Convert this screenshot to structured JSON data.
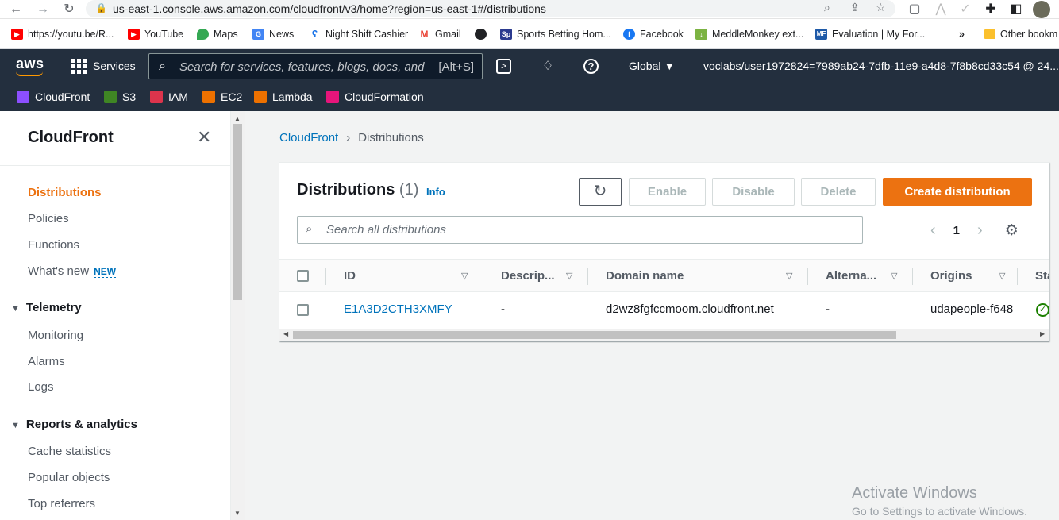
{
  "browser": {
    "url": "us-east-1.console.aws.amazon.com/cloudfront/v3/home?region=us-east-1#/distributions",
    "bookmarks": [
      {
        "label": "https://youtu.be/R...",
        "icon": "youtube-icon"
      },
      {
        "label": "YouTube",
        "icon": "youtube-icon"
      },
      {
        "label": "Maps",
        "icon": "maps-icon"
      },
      {
        "label": "News",
        "icon": "news-icon"
      },
      {
        "label": "Night Shift Cashier",
        "icon": "bookmark-icon"
      },
      {
        "label": "Gmail",
        "icon": "gmail-icon"
      },
      {
        "label": "",
        "icon": "globe-icon"
      },
      {
        "label": "Sports Betting Hom...",
        "icon": "sp-icon"
      },
      {
        "label": "Facebook",
        "icon": "facebook-icon"
      },
      {
        "label": "MeddleMonkey ext...",
        "icon": "download-icon"
      },
      {
        "label": "Evaluation | My For...",
        "icon": "mf-icon"
      }
    ],
    "overflow": "»",
    "other_bookmarks": "Other bookm"
  },
  "aws": {
    "logo": "aws",
    "services_label": "Services",
    "search_placeholder": "Search for services, features, blogs, docs, and",
    "search_shortcut": "[Alt+S]",
    "region": "Global",
    "account": "voclabs/user1972824=7989ab24-7dfb-11e9-a4d8-7f8b8cd33c54 @ 24...",
    "favorites": [
      {
        "label": "CloudFront",
        "color": "#8c4fff"
      },
      {
        "label": "S3",
        "color": "#3f8624"
      },
      {
        "label": "IAM",
        "color": "#dd344c"
      },
      {
        "label": "EC2",
        "color": "#ed7100"
      },
      {
        "label": "Lambda",
        "color": "#ed7100"
      },
      {
        "label": "CloudFormation",
        "color": "#e7157b"
      }
    ]
  },
  "sidebar": {
    "title": "CloudFront",
    "items": [
      "Distributions",
      "Policies",
      "Functions",
      "What's new"
    ],
    "new_badge": "NEW",
    "telemetry": {
      "title": "Telemetry",
      "items": [
        "Monitoring",
        "Alarms",
        "Logs"
      ]
    },
    "reports": {
      "title": "Reports & analytics",
      "items": [
        "Cache statistics",
        "Popular objects",
        "Top referrers"
      ]
    }
  },
  "breadcrumb": {
    "root": "CloudFront",
    "current": "Distributions"
  },
  "panel": {
    "title": "Distributions",
    "count": "(1)",
    "info": "Info",
    "buttons": {
      "enable": "Enable",
      "disable": "Disable",
      "delete": "Delete",
      "create": "Create distribution"
    },
    "search_placeholder": "Search all distributions",
    "page": "1",
    "columns": [
      "ID",
      "Descrip...",
      "Domain name",
      "Alterna...",
      "Origins",
      "Sta"
    ],
    "rows": [
      {
        "id": "E1A3D2CTH3XMFY",
        "description": "-",
        "domain": "d2wz8fgfccmoom.cloudfront.net",
        "alternate": "-",
        "origins": "udapeople-f648"
      }
    ]
  },
  "watermark": {
    "line1": "Activate Windows",
    "line2": "Go to Settings to activate Windows."
  },
  "colors": {
    "aws_nav": "#232f3e",
    "accent": "#ec7211",
    "link": "#0073bb"
  }
}
